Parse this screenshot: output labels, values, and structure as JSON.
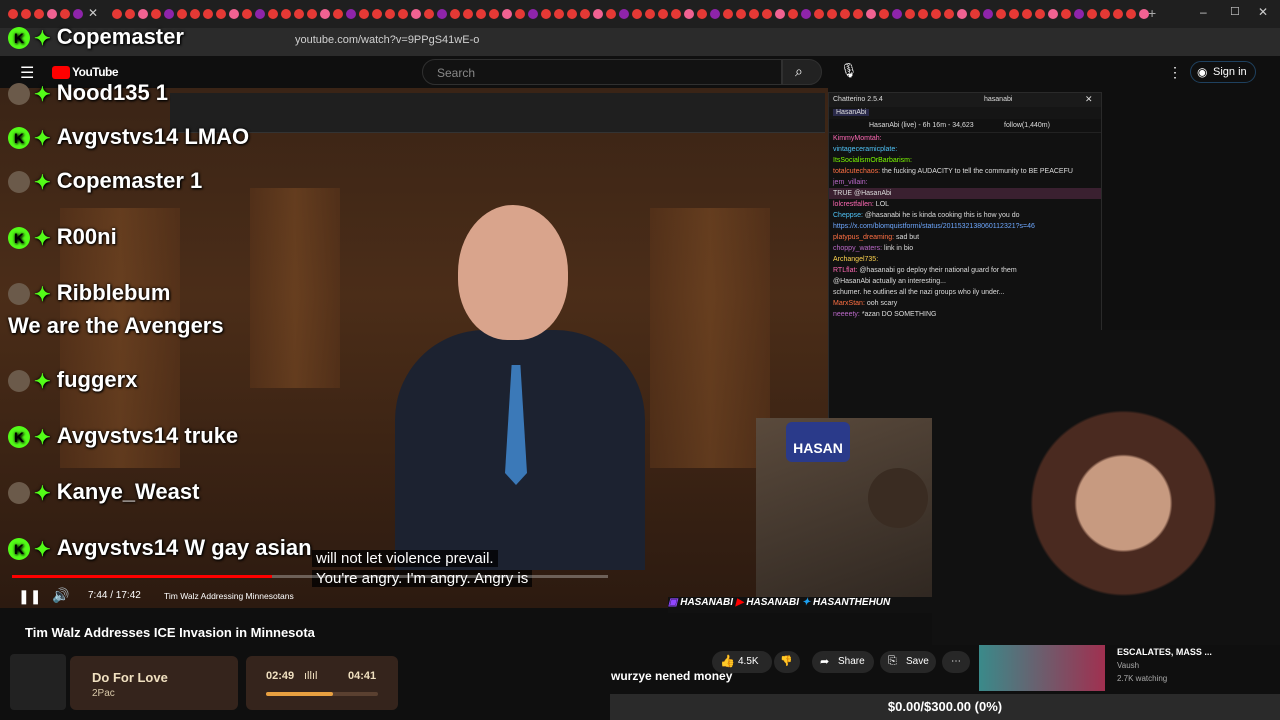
{
  "browser": {
    "url": "youtube.com/watch?v=9PPgS41wE-o"
  },
  "header": {
    "logo": "YouTube",
    "search_placeholder": "Search",
    "signin": "Sign in"
  },
  "chat_overlay": [
    {
      "user": "Copemaster",
      "msg": ""
    },
    {
      "user": "Nood135",
      "msg": "1"
    },
    {
      "user": "Avgvstvs14",
      "msg": "LMAO"
    },
    {
      "user": "Copemaster",
      "msg": "1"
    },
    {
      "user": "R00ni",
      "msg": ""
    },
    {
      "user": "Ribblebum",
      "msg": ""
    },
    {
      "user": "",
      "msg": "We are the Avengers"
    },
    {
      "user": "fuggerx",
      "msg": ""
    },
    {
      "user": "Avgvstvs14",
      "msg": "truke"
    },
    {
      "user": "Kanye_Weast",
      "msg": ""
    },
    {
      "user": "Avgvstvs14",
      "msg": "W gay asian"
    }
  ],
  "video": {
    "caption_line1": "will not let violence prevail.",
    "caption_line2": "You're angry. I'm angry. Angry is",
    "time": "7:44 / 17:42",
    "chapter": "Tim Walz Addressing Minnesotans",
    "progress_fraction": 0.437,
    "title": "Tim Walz Addresses ICE Invasion in Minnesota"
  },
  "chatterino": {
    "app_title": "Chatterino 2.5.4",
    "channel": "hasanabi",
    "tab": "HasanAbi",
    "stream_info": "HasanAbi (live) - 6h 16m - 34,623",
    "follow": "follow(1,440m)",
    "messages": [
      {
        "user": "KimmyMomtah:",
        "text": ""
      },
      {
        "user": "vintageceramicplate:",
        "text": ""
      },
      {
        "user": "ItsSocialismOrBarbarism:",
        "text": ""
      },
      {
        "user": "totalcutechaos:",
        "text": "the fucking AUDACITY to tell the community to BE PEACEFU"
      },
      {
        "user": "jem_villain:",
        "text": ""
      },
      {
        "user": "",
        "text": "TRUE @HasanAbi"
      },
      {
        "user": "lolcrestfallen:",
        "text": "LOL"
      },
      {
        "user": "Cheppse:",
        "text": "@hasanabi he is kinda cooking this is how you do"
      },
      {
        "user": "",
        "text": "https://x.com/blomquistformi/status/2011532138060112321?s=46"
      },
      {
        "user": "platypus_dreaming:",
        "text": "sad but"
      },
      {
        "user": "choppy_waters:",
        "text": "link in bio"
      },
      {
        "user": "Archangel735:",
        "text": ""
      },
      {
        "user": "RTLflat:",
        "text": "@hasanabi go deploy their national guard for them"
      },
      {
        "user": "",
        "text": "@HasanAbi actually an interesting..."
      },
      {
        "user": "",
        "text": "schumer. he outlines all the nazi groups who ily under..."
      },
      {
        "user": "MarxStan:",
        "text": "ooh scary"
      },
      {
        "user": "neeeety:",
        "text": "*azan DO SOMETHING"
      }
    ]
  },
  "actions": {
    "likes": "4.5K",
    "share": "Share",
    "save": "Save"
  },
  "spotify": {
    "song": "Do For Love",
    "artist": "2Pac",
    "elapsed": "02:49",
    "total": "04:41",
    "progress_fraction": 0.6
  },
  "overlay_text": "wurzye nened money",
  "goal": "$0.00/$300.00 (0%)",
  "recommendation": {
    "title": "ESCALATES, MASS ...",
    "channel": "Vaush",
    "watching": "2.7K watching"
  },
  "colors": {
    "kick_green": "#53fc18",
    "yt_red": "#ff0000",
    "twitch_purple": "#9146ff"
  }
}
